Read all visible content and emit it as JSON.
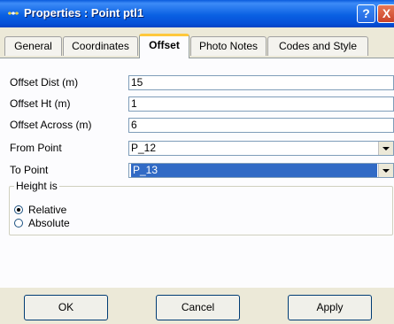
{
  "window": {
    "title": "Properties : Point ptl1",
    "help_glyph": "?",
    "close_glyph": "X"
  },
  "tabs": [
    {
      "label": "General"
    },
    {
      "label": "Coordinates"
    },
    {
      "label": "Offset",
      "active": true
    },
    {
      "label": "Photo Notes"
    },
    {
      "label": "Codes and Style"
    }
  ],
  "fields": [
    {
      "label": "Offset Dist (m)",
      "value": "15"
    },
    {
      "label": "Offset Ht (m)",
      "value": "1"
    },
    {
      "label": "Offset Across (m)",
      "value": "6"
    }
  ],
  "combos": [
    {
      "label": "From Point",
      "value": "P_12"
    },
    {
      "label": "To Point",
      "value": "P_13",
      "selected": true
    }
  ],
  "height_group": {
    "legend": "Height is",
    "options": [
      {
        "label": "Relative",
        "checked": true
      },
      {
        "label": "Absolute",
        "checked": false
      }
    ]
  },
  "buttons": {
    "ok": "OK",
    "cancel": "Cancel",
    "apply": "Apply"
  },
  "colors": {
    "titlebar": "#0A5BDC",
    "selection": "#316AC5",
    "active_tab_accent": "#FFC83C",
    "dialog_bg": "#ECE9D8"
  }
}
